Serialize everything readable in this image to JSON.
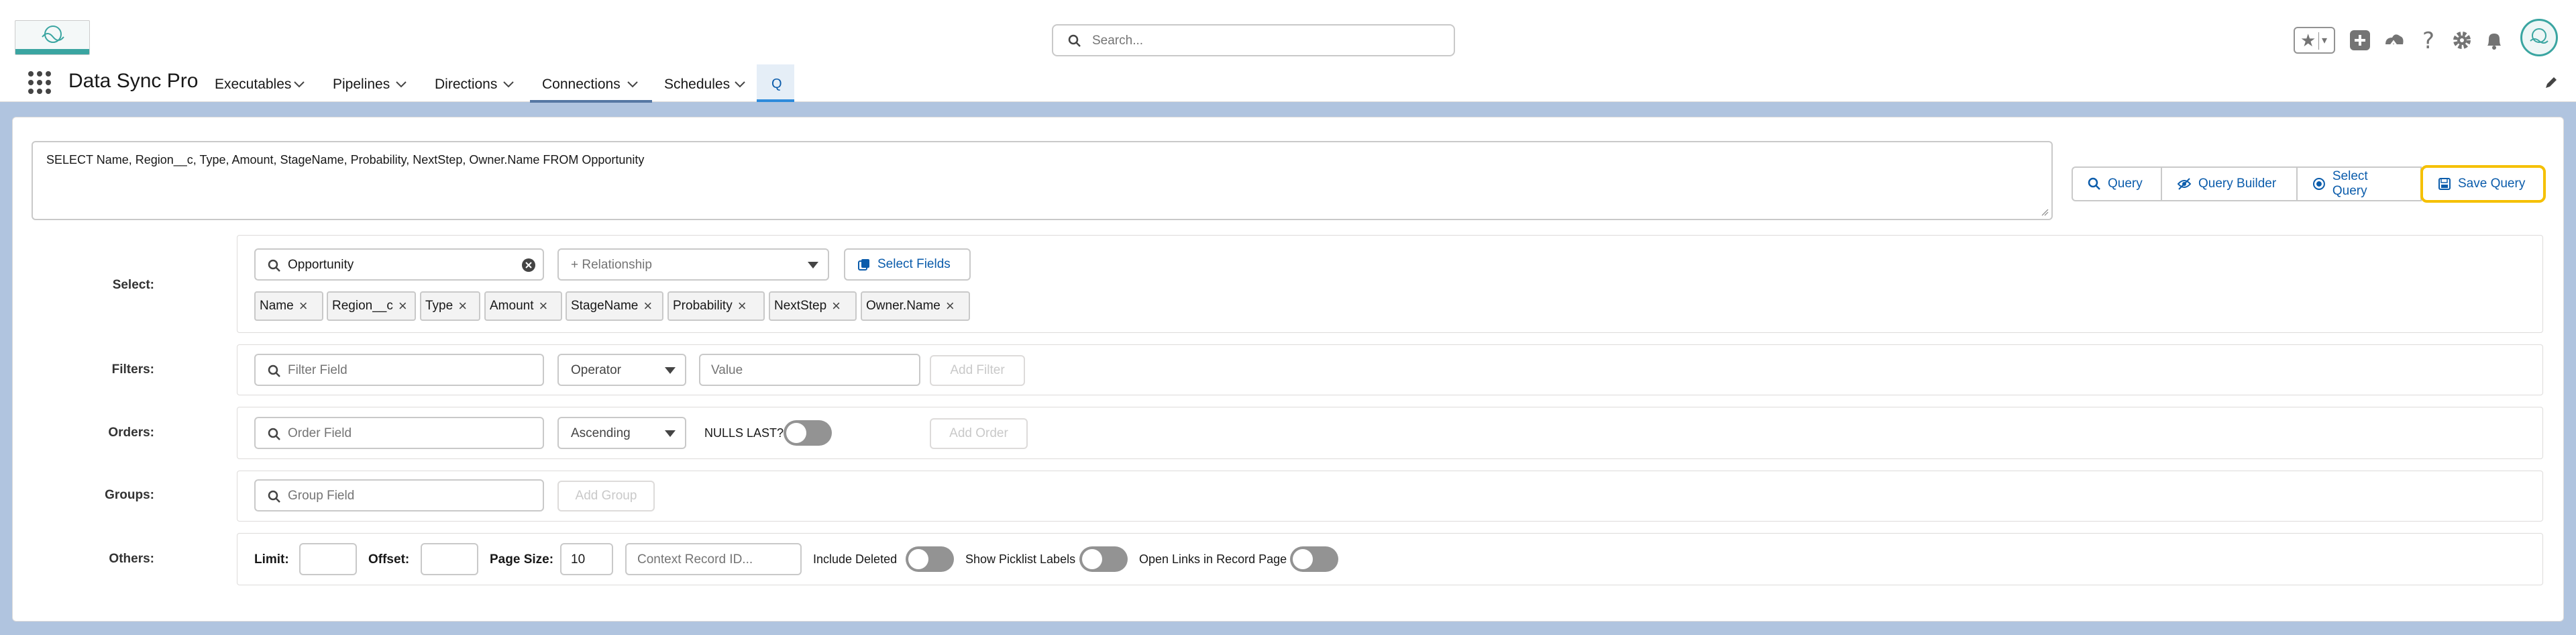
{
  "app": {
    "name": "Data Sync Pro"
  },
  "header": {
    "search_placeholder": "Search..."
  },
  "nav": {
    "items": [
      {
        "label": "Executables"
      },
      {
        "label": "Pipelines"
      },
      {
        "label": "Directions"
      },
      {
        "label": "Connections",
        "selected": true
      },
      {
        "label": "Schedules"
      }
    ],
    "query_tab": "Q"
  },
  "query": {
    "soql": "SELECT Name, Region__c, Type, Amount, StageName, Probability, NextStep, Owner.Name FROM Opportunity"
  },
  "actions": {
    "query": "Query",
    "query_builder": "Query Builder",
    "select_query": "Select Query",
    "save_query": "Save Query"
  },
  "select": {
    "label": "Select:",
    "object_value": "Opportunity",
    "relationship_placeholder": "+ Relationship",
    "select_fields": "Select Fields",
    "fields": [
      "Name",
      "Region__c",
      "Type",
      "Amount",
      "StageName",
      "Probability",
      "NextStep",
      "Owner.Name"
    ]
  },
  "filters": {
    "label": "Filters:",
    "field_placeholder": "Filter Field",
    "operator_placeholder": "Operator",
    "value_placeholder": "Value",
    "add_button": "Add Filter"
  },
  "orders": {
    "label": "Orders:",
    "field_placeholder": "Order Field",
    "direction": "Ascending",
    "nulls_last_label": "NULLS LAST?",
    "nulls_last": false,
    "add_button": "Add Order"
  },
  "groups": {
    "label": "Groups:",
    "field_placeholder": "Group Field",
    "add_button": "Add Group"
  },
  "others": {
    "label": "Others:",
    "limit_label": "Limit:",
    "limit_value": "",
    "offset_label": "Offset:",
    "offset_value": "",
    "page_size_label": "Page Size:",
    "page_size_value": "10",
    "context_placeholder": "Context Record ID...",
    "include_deleted_label": "Include Deleted",
    "include_deleted": false,
    "show_picklist_label": "Show Picklist Labels",
    "show_picklist": false,
    "open_links_label": "Open Links in Record Page",
    "open_links": false
  },
  "colors": {
    "brand_blue": "#0b5cab",
    "highlight": "#f5c000",
    "page_bg": "#b0c4df",
    "toggle_off": "#939393"
  }
}
